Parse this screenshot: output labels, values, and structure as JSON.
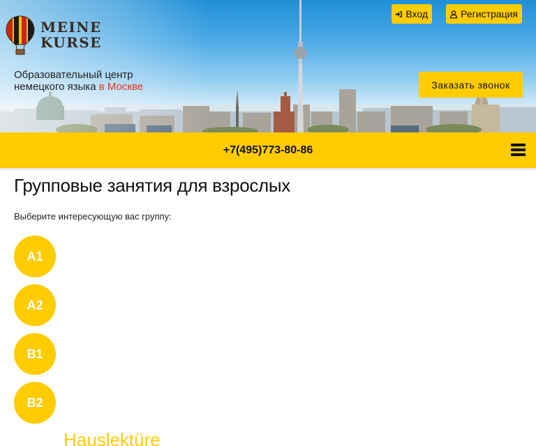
{
  "header": {
    "logo": {
      "line1": "MEINE",
      "line2": "KURSE"
    },
    "tagline": {
      "line1": "Образовательный центр",
      "line2_main": "немецкого языка",
      "line2_accent": "в Москве"
    },
    "login_label": "Вход",
    "register_label": "Регистрация",
    "callback_label": "Заказать звонок"
  },
  "phone_bar": {
    "phone": "+7(495)773-80-86"
  },
  "main": {
    "title": "Групповые занятия для взрослых",
    "prompt": "Выберите интересующую вас группу:",
    "levels": [
      {
        "label": "A1"
      },
      {
        "label": "A2"
      },
      {
        "label": "B1"
      },
      {
        "label": "B2"
      }
    ],
    "section_heading": "Hauslektüre"
  },
  "colors": {
    "accent_yellow": "#ffcc00",
    "accent_red": "#e8341c",
    "text_dark": "#111111"
  },
  "icons": {
    "login": "sign-in-icon",
    "register": "user-icon",
    "menu": "hamburger-menu-icon",
    "logo": "hot-air-balloon-icon"
  }
}
